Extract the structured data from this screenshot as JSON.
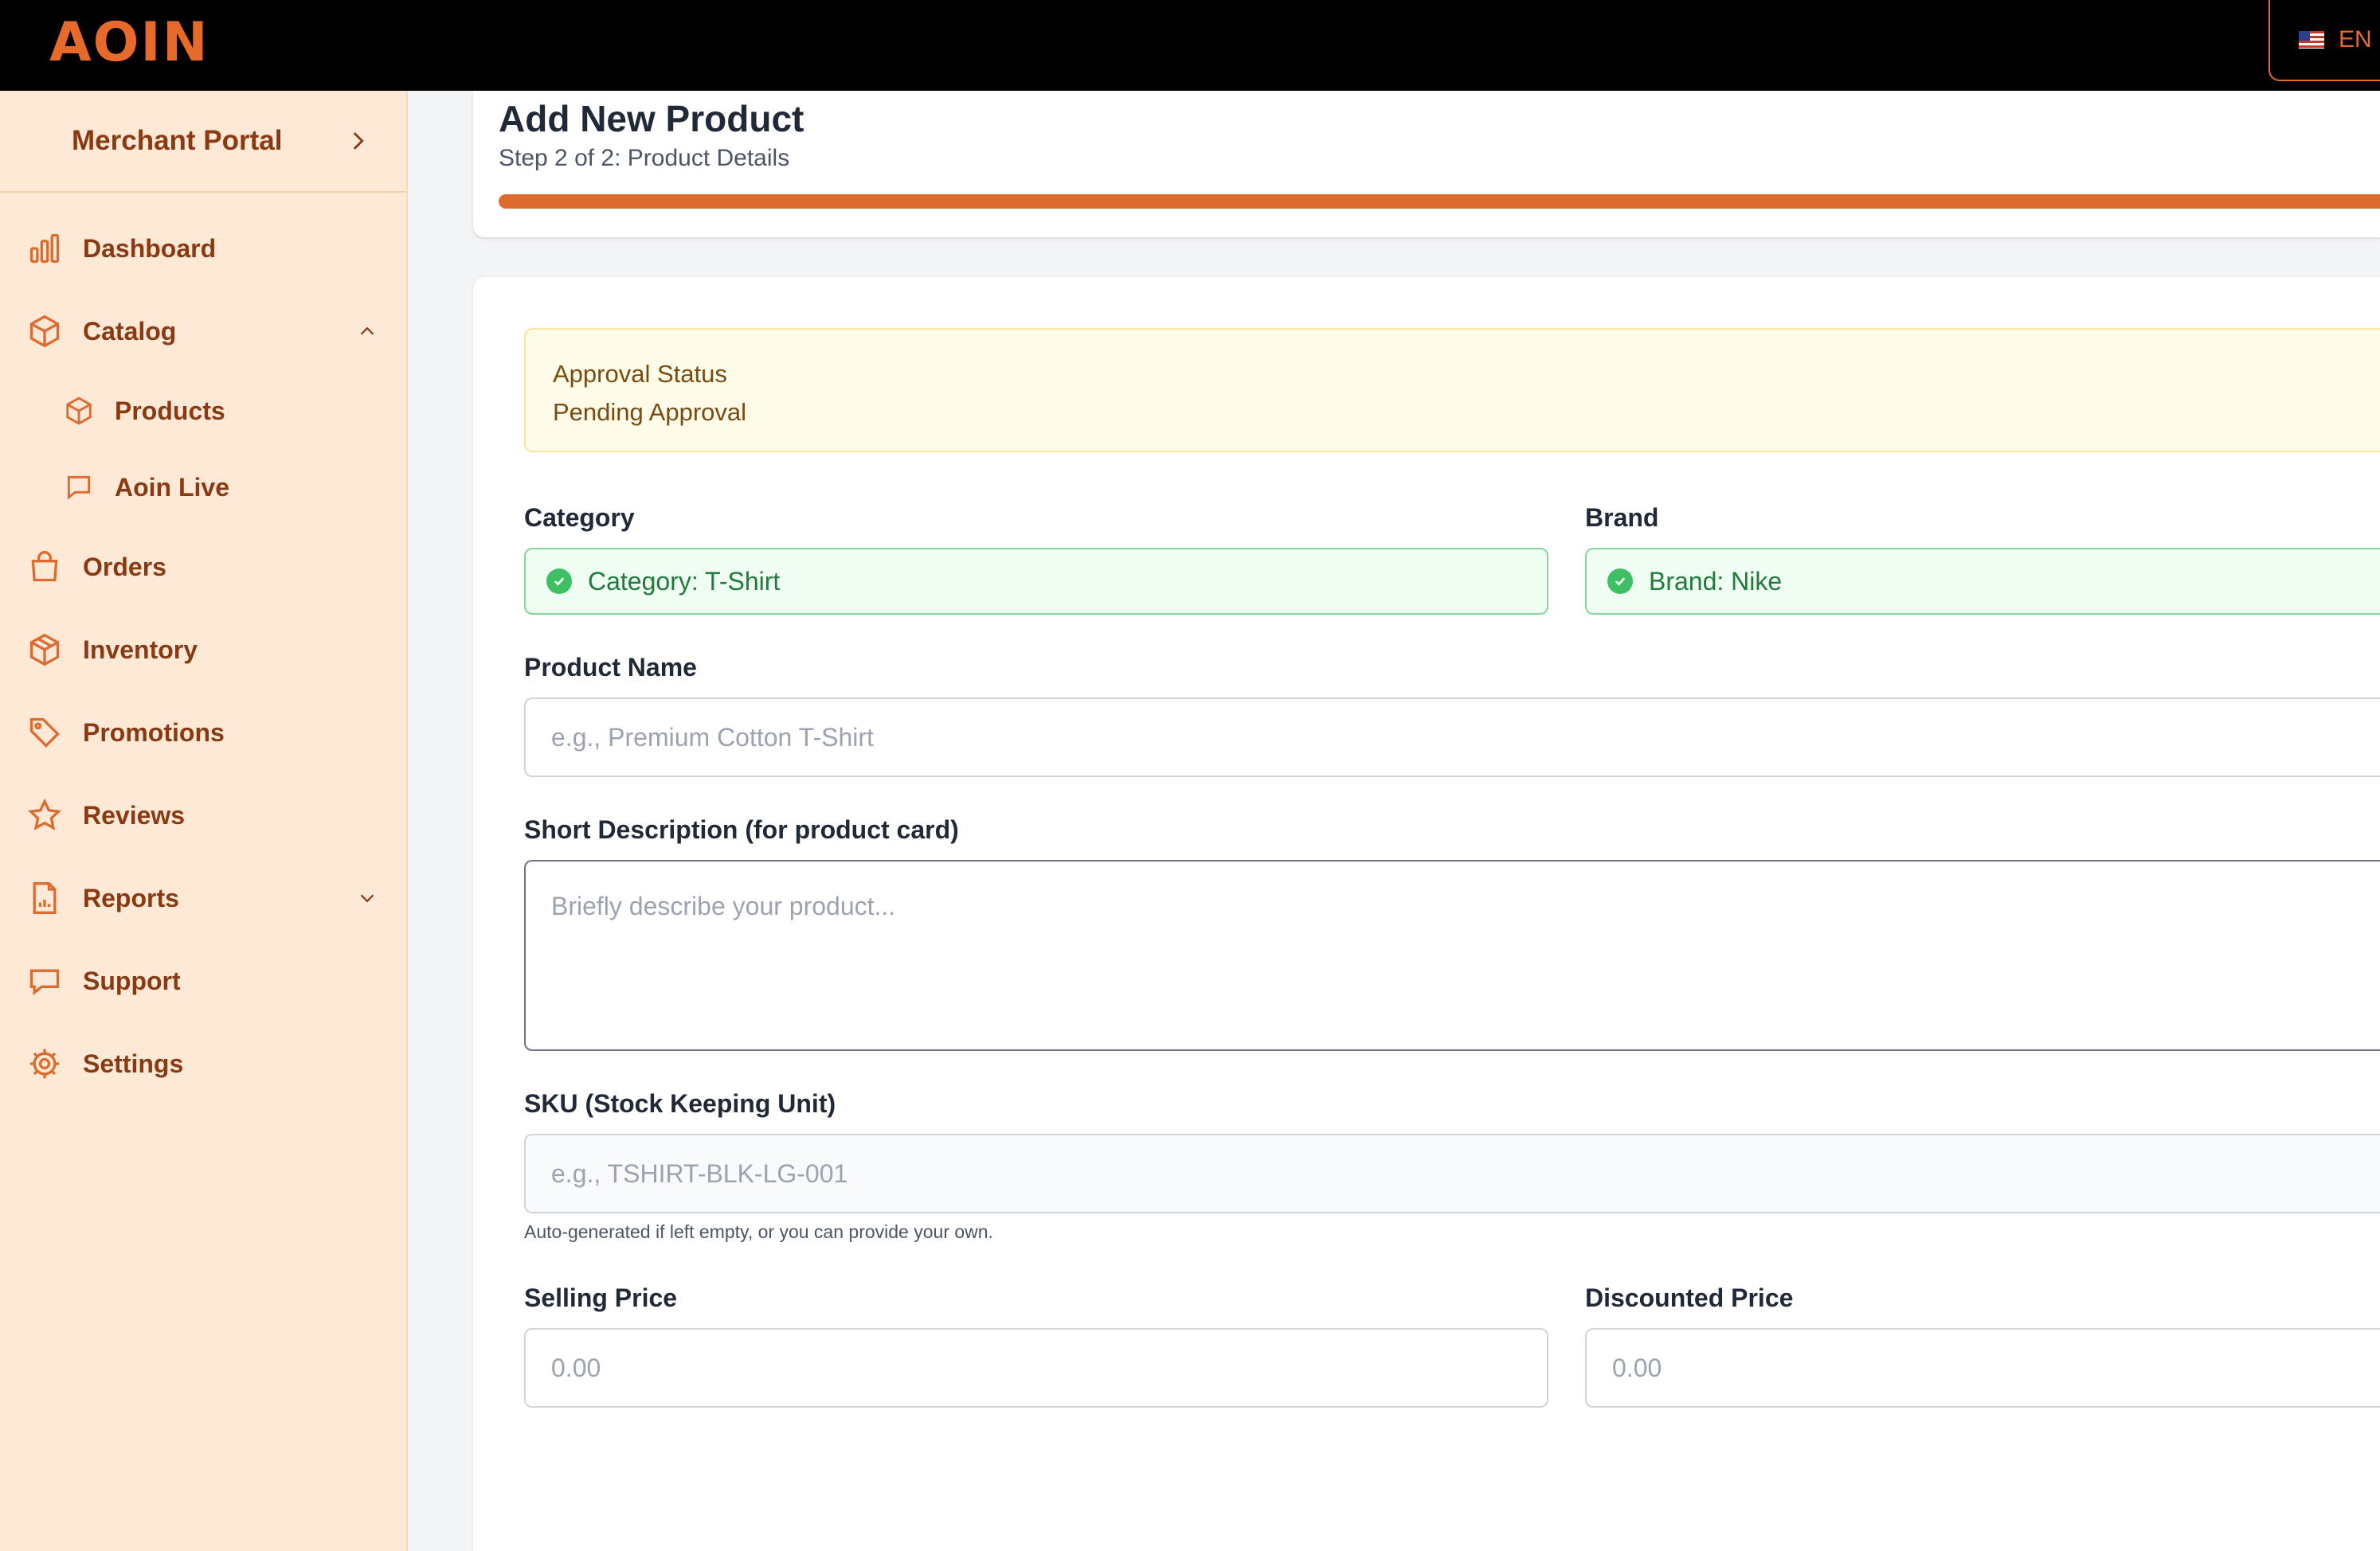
{
  "brand": {
    "logo_text": "AOIN"
  },
  "topbar": {
    "language": "EN"
  },
  "sidebar": {
    "portal_label": "Merchant Portal",
    "items": [
      {
        "label": "Dashboard"
      },
      {
        "label": "Catalog"
      },
      {
        "label": "Products"
      },
      {
        "label": "Aoin Live"
      },
      {
        "label": "Orders"
      },
      {
        "label": "Inventory"
      },
      {
        "label": "Promotions"
      },
      {
        "label": "Reviews"
      },
      {
        "label": "Reports"
      },
      {
        "label": "Support"
      },
      {
        "label": "Settings"
      }
    ]
  },
  "header": {
    "title": "Add New Product",
    "subtitle": "Step 2 of 2: Product Details",
    "progress": 1.0
  },
  "approval": {
    "title": "Approval Status",
    "status": "Pending Approval"
  },
  "form": {
    "category_label": "Category",
    "category_value": "Category: T-Shirt",
    "brand_label": "Brand",
    "brand_value": "Brand: Nike",
    "name_label": "Product Name",
    "name_placeholder": "e.g., Premium Cotton T-Shirt",
    "short_desc_label": "Short Description (for product card)",
    "short_desc_placeholder": "Briefly describe your product...",
    "sku_label": "SKU (Stock Keeping Unit)",
    "sku_placeholder": "e.g., TSHIRT-BLK-LG-001",
    "sku_hint": "Auto-generated if left empty, or you can provide your own.",
    "selling_label": "Selling Price",
    "selling_placeholder": "0.00",
    "discounted_label": "Discounted Price",
    "discounted_placeholder": "0.00"
  },
  "colors": {
    "accent": "#dd6a2e",
    "sidebar_bg": "#fde9d6",
    "sidebar_text": "#8a3a12"
  }
}
